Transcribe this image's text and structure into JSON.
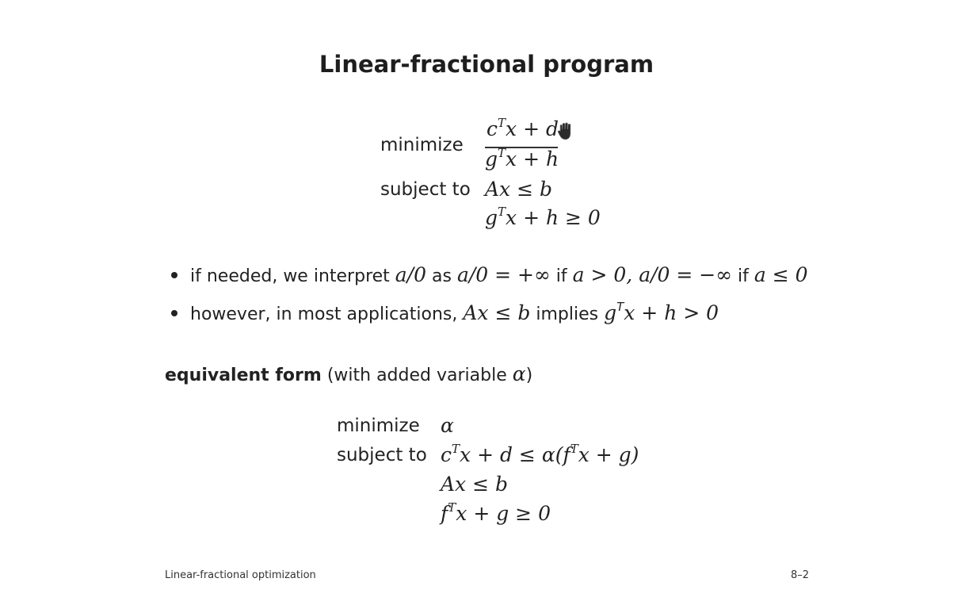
{
  "slide": {
    "title": "Linear-fractional program",
    "program1": {
      "objective_label": "minimize",
      "numerator": {
        "c": "c",
        "sup": "T",
        "rest": "x + d"
      },
      "denominator": {
        "g": "g",
        "sup": "T",
        "rest": "x + h"
      },
      "constraint_label": "subject to",
      "constraint1": "Ax ≤ b",
      "constraint2": {
        "g": "g",
        "sup": "T",
        "rest": "x + h ≥ 0"
      }
    },
    "bullets": [
      {
        "text_a": "if needed, we interpret ",
        "math_a": "a/0",
        "text_b": " as ",
        "math_b": "a/0 = +∞",
        "text_c": " if ",
        "math_c": "a > 0, a/0 = −∞",
        "text_d": " if ",
        "math_d": "a ≤ 0"
      },
      {
        "text_a": "however, in most applications, ",
        "math_a": "Ax ≤ b",
        "text_b": " implies ",
        "math_b_g": "g",
        "math_b_sup": "T",
        "math_b_rest": "x + h > 0"
      }
    ],
    "section": {
      "bold": "equivalent form",
      "rest": " (with added variable ",
      "alpha": "α",
      "close": ")"
    },
    "program2": {
      "objective_label": "minimize",
      "objective": "α",
      "constraint_label": "subject to",
      "constraint1": {
        "c": "c",
        "sup": "T",
        "mid": "x + d ≤ α(f",
        "sup2": "T",
        "rest": "x + g)"
      },
      "constraint2": "Ax ≤ b",
      "constraint3": {
        "f": "f",
        "sup": "T",
        "rest": "x + g ≥ 0"
      }
    },
    "footer": {
      "left": "Linear-fractional optimization",
      "right": "8–2"
    },
    "cursor_icon": "hand-grab-icon"
  }
}
